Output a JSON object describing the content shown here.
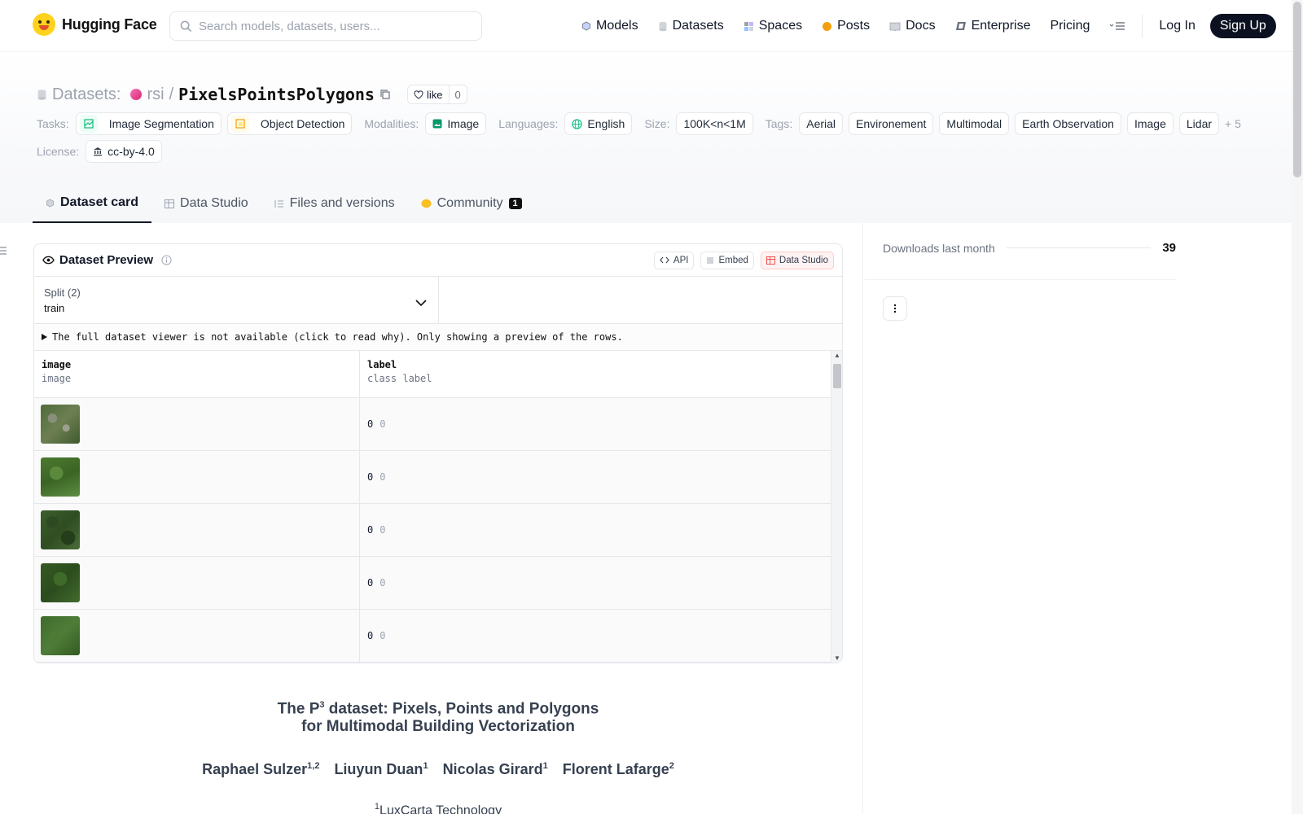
{
  "header": {
    "logo_text": "Hugging Face",
    "search_placeholder": "Search models, datasets, users...",
    "nav": [
      {
        "label": "Models",
        "icon": "models-cube-icon"
      },
      {
        "label": "Datasets",
        "icon": "datasets-db-icon"
      },
      {
        "label": "Spaces",
        "icon": "spaces-grid-icon"
      },
      {
        "label": "Posts",
        "icon": "posts-bubble-icon"
      },
      {
        "label": "Docs",
        "icon": "docs-book-icon"
      },
      {
        "label": "Enterprise",
        "icon": "enterprise-icon"
      },
      {
        "label": "Pricing"
      }
    ],
    "login": "Log In",
    "signup": "Sign Up"
  },
  "repo": {
    "section": "Datasets:",
    "org": "rsi",
    "sep": "/",
    "name": "PixelsPointsPolygons",
    "like_label": "like",
    "like_count": "0"
  },
  "tags": {
    "tasks_label": "Tasks:",
    "tasks": [
      "Image Segmentation",
      "Object Detection"
    ],
    "modalities_label": "Modalities:",
    "modalities": [
      "Image"
    ],
    "languages_label": "Languages:",
    "languages": [
      "English"
    ],
    "size_label": "Size:",
    "size": "100K<n<1M",
    "tags_label": "Tags:",
    "tags": [
      "Aerial",
      "Environement",
      "Multimodal",
      "Earth Observation",
      "Image",
      "Lidar"
    ],
    "more": "+ 5",
    "license_label": "License:",
    "license": "cc-by-4.0"
  },
  "tabs": [
    {
      "label": "Dataset card",
      "active": true
    },
    {
      "label": "Data Studio"
    },
    {
      "label": "Files and versions"
    },
    {
      "label": "Community",
      "badge": "1"
    }
  ],
  "preview": {
    "title": "Dataset Preview",
    "api": "API",
    "embed": "Embed",
    "studio": "Data Studio",
    "split_label": "Split (2)",
    "split_value": "train",
    "notice": "The full dataset viewer is not available (click to read why). Only showing a preview of the rows.",
    "columns": [
      {
        "name": "image",
        "type": "image"
      },
      {
        "name": "label",
        "type": "class label"
      }
    ],
    "rows": [
      {
        "label": "0",
        "label_name": "0"
      },
      {
        "label": "0",
        "label_name": "0"
      },
      {
        "label": "0",
        "label_name": "0"
      },
      {
        "label": "0",
        "label_name": "0"
      },
      {
        "label": "0",
        "label_name": "0"
      }
    ]
  },
  "card": {
    "title_part1": "The P",
    "title_sup": "3",
    "title_part2": " dataset: Pixels, Points and Polygons",
    "title_line2": "for Multimodal Building Vectorization",
    "authors": [
      {
        "name": "Raphael Sulzer",
        "sup": "1,2"
      },
      {
        "name": "Liuyun Duan",
        "sup": "1"
      },
      {
        "name": "Nicolas Girard",
        "sup": "1"
      },
      {
        "name": "Florent Lafarge",
        "sup": "2"
      }
    ],
    "affiliation_sup": "1",
    "affiliation": "LuxCarta Technology"
  },
  "sidebar": {
    "downloads_label": "Downloads last month",
    "downloads_value": "39"
  },
  "colors": {
    "accent_dark": "#0b1120",
    "posts": "#f59e0b",
    "org": "#db2777"
  }
}
